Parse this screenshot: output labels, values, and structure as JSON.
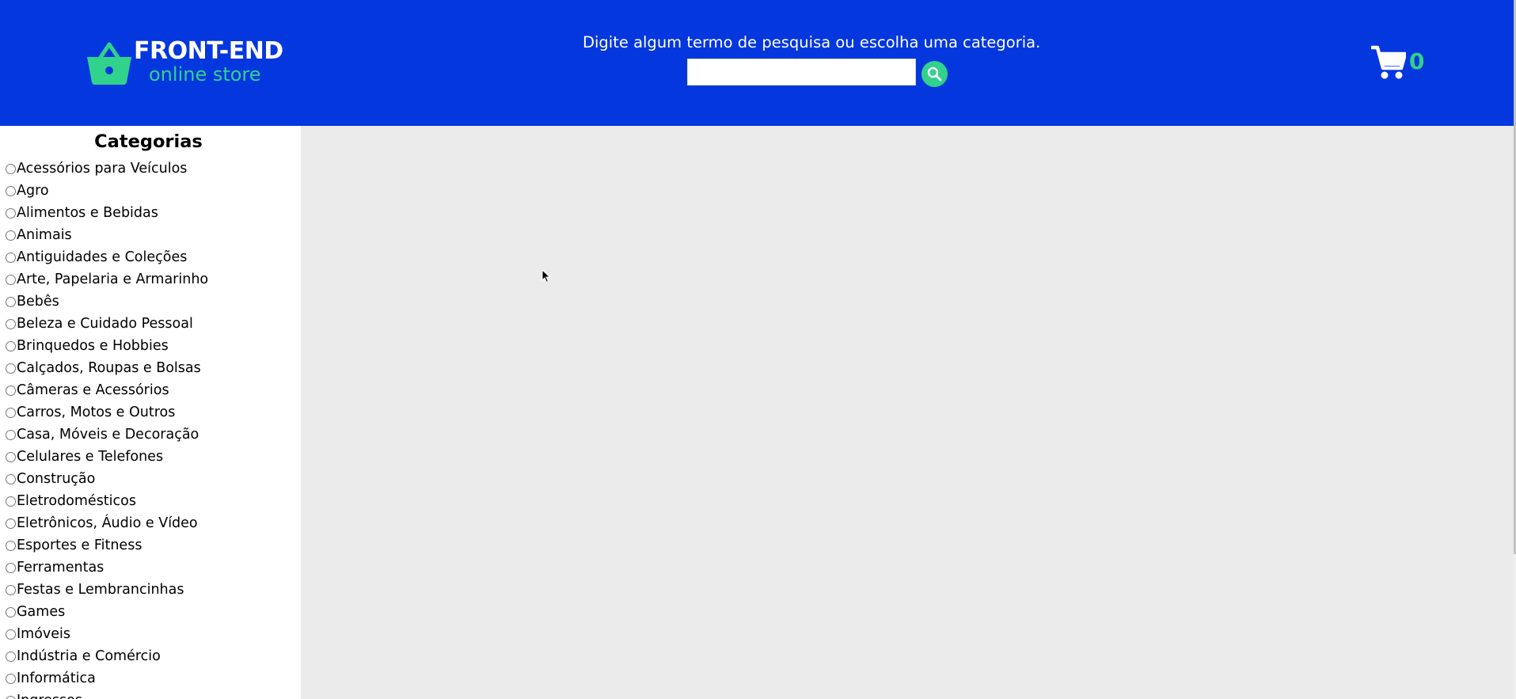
{
  "header": {
    "logo": {
      "title": "FRONT-END",
      "subtitle": "online store"
    },
    "search": {
      "hint": "Digite algum termo de pesquisa ou escolha uma categoria.",
      "value": "",
      "placeholder": ""
    },
    "cart": {
      "count": "0"
    }
  },
  "sidebar": {
    "title": "Categorias",
    "categories": [
      "Acessórios para Veículos",
      "Agro",
      "Alimentos e Bebidas",
      "Animais",
      "Antiguidades e Coleções",
      "Arte, Papelaria e Armarinho",
      "Bebês",
      "Beleza e Cuidado Pessoal",
      "Brinquedos e Hobbies",
      "Calçados, Roupas e Bolsas",
      "Câmeras e Acessórios",
      "Carros, Motos e Outros",
      "Casa, Móveis e Decoração",
      "Celulares e Telefones",
      "Construção",
      "Eletrodomésticos",
      "Eletrônicos, Áudio e Vídeo",
      "Esportes e Fitness",
      "Ferramentas",
      "Festas e Lembrancinhas",
      "Games",
      "Imóveis",
      "Indústria e Comércio",
      "Informática",
      "Ingressos"
    ]
  },
  "colors": {
    "header_bg": "#0437dd",
    "accent": "#31d28b",
    "content_bg": "#ebebeb"
  },
  "icons": {
    "logo": "shopping-basket-icon",
    "search": "magnifier-icon",
    "cart": "shopping-cart-icon"
  }
}
